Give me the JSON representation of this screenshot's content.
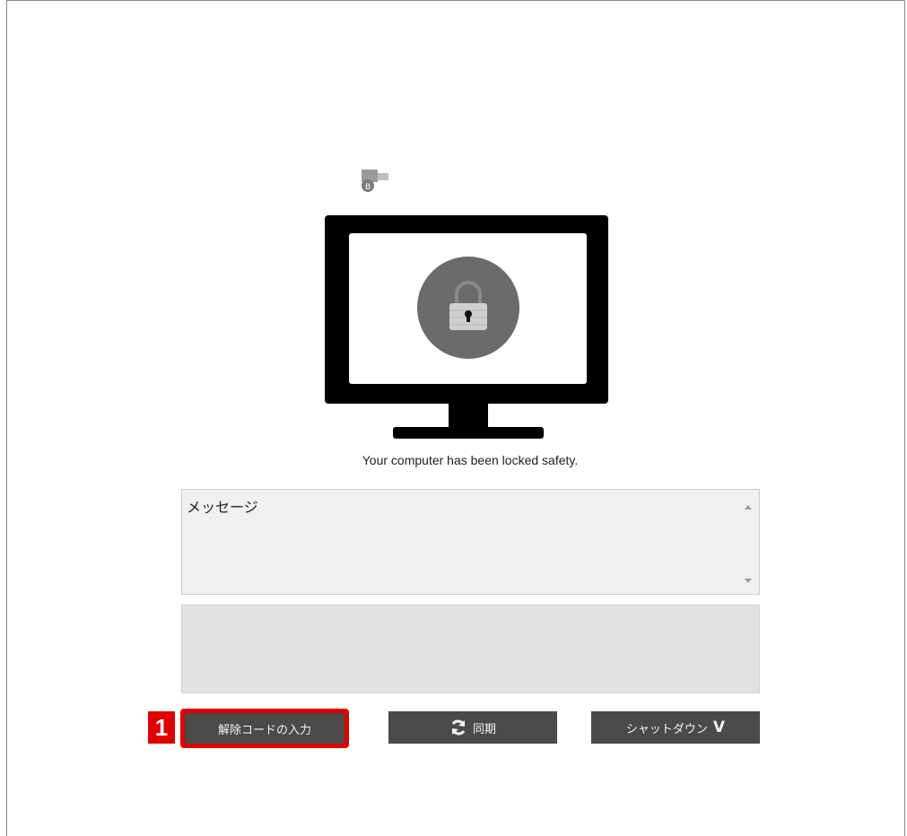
{
  "status_message": "Your computer has been locked safety.",
  "message_box": {
    "label": "メッセージ"
  },
  "buttons": {
    "unlock_label": "解除コードの入力",
    "sync_label": "同期",
    "shutdown_label": "シャットダウン",
    "shutdown_chevron": "V"
  },
  "annotation": {
    "step_number": "1"
  },
  "icons": {
    "small": "bitlocker-like-icon",
    "monitor": "monitor-icon",
    "lock": "padlock-icon",
    "sync": "refresh-icon"
  },
  "colors": {
    "button_bg": "#4a4a4a",
    "highlight": "#e00000",
    "panel_bg": "#e2e2e2"
  }
}
